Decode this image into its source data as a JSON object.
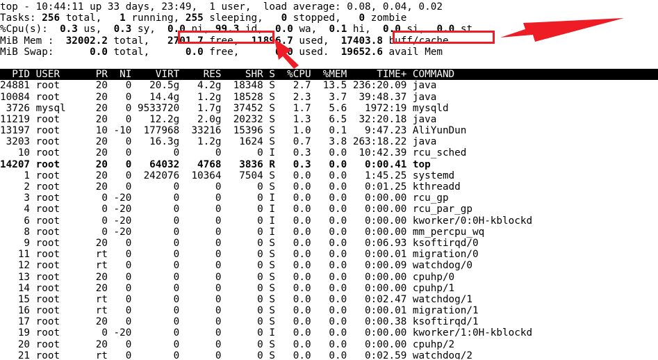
{
  "terminal": {
    "app": "top",
    "summary": {
      "line1": "top - 10:44:11 up 33 days, 23:49,  1 user,  load average: 0.08, 0.04, 0.02",
      "line2": "Tasks: 256 total,   1 running, 255 sleeping,   0 stopped,   0 zombie",
      "line3": "%Cpu(s):  0.3 us,  0.3 sy,  0.0 ni, 99.3 id,  0.0 wa,  0.1 hi,  0.0 si,  0.0 st",
      "line4": "MiB Mem :  32002.2 total,   2701.7 free,  11896.7 used,  17403.8 buff/cache",
      "line5": "MiB Swap:      0.0 total,      0.0 free,      0.0 used.  19652.6 avail Mem",
      "uptime_time": "10:44:11",
      "up_days": "33 days, 23:49",
      "users": "1 user",
      "load_average": [
        "0.08",
        "0.04",
        "0.02"
      ],
      "tasks": {
        "total": "256",
        "running": "1",
        "sleeping": "255",
        "stopped": "0",
        "zombie": "0"
      },
      "cpu": {
        "us": "0.3",
        "sy": "0.3",
        "ni": "0.0",
        "id": "99.3",
        "wa": "0.0",
        "hi": "0.1",
        "si": "0.0",
        "st": "0.0"
      },
      "mem": {
        "unit": "MiB Mem :",
        "total": "32002.2",
        "free": "2701.7",
        "used": "11896.7",
        "buff_cache": "17403.8"
      },
      "swap": {
        "unit": "MiB Swap:",
        "total": "0.0",
        "free": "0.0",
        "used": "0.0",
        "avail_mem": "19652.6"
      }
    },
    "columns_line": "  PID USER      PR  NI    VIRT    RES    SHR S  %CPU  %MEM     TIME+ COMMAND                                                                      ",
    "columns": [
      "PID",
      "USER",
      "PR",
      "NI",
      "VIRT",
      "RES",
      "SHR",
      "S",
      "%CPU",
      "%MEM",
      "TIME+",
      "COMMAND"
    ],
    "rows": [
      {
        "line": "24881 root      20   0   20.5g   4.2g  18348 S   2.7  13.5 236:20.09 java",
        "bold": false
      },
      {
        "line": "10084 root      20   0   14.4g   1.2g  18528 S   2.3   3.7  39:48.37 java",
        "bold": false
      },
      {
        "line": " 3726 mysql     20   0 9533720   1.7g  37452 S   1.7   5.6   1972:19 mysqld",
        "bold": false
      },
      {
        "line": "11219 root      20   0   12.2g   2.0g  20232 S   1.3   6.5  32:20.18 java",
        "bold": false
      },
      {
        "line": "13197 root      10 -10  177968  33216  15396 S   1.0   0.1   9:47.23 AliYunDun",
        "bold": false
      },
      {
        "line": " 3203 root      20   0   16.3g   1.2g   1624 S   0.7   3.8 263:18.22 java",
        "bold": false
      },
      {
        "line": "   10 root      20   0       0      0      0 I   0.3   0.0  10:42.39 rcu_sched",
        "bold": false
      },
      {
        "line": "14207 root      20   0   64032   4768   3836 R   0.3   0.0   0:00.41 top",
        "bold": true
      },
      {
        "line": "    1 root      20   0  242076  10364   7504 S   0.0   0.0   1:45.25 systemd",
        "bold": false
      },
      {
        "line": "    2 root      20   0       0      0      0 S   0.0   0.0   0:01.25 kthreadd",
        "bold": false
      },
      {
        "line": "    3 root       0 -20       0      0      0 I   0.0   0.0   0:00.00 rcu_gp",
        "bold": false
      },
      {
        "line": "    4 root       0 -20       0      0      0 I   0.0   0.0   0:00.00 rcu_par_gp",
        "bold": false
      },
      {
        "line": "    6 root       0 -20       0      0      0 I   0.0   0.0   0:00.00 kworker/0:0H-kblockd",
        "bold": false
      },
      {
        "line": "    8 root       0 -20       0      0      0 I   0.0   0.0   0:00.00 mm_percpu_wq",
        "bold": false
      },
      {
        "line": "    9 root      20   0       0      0      0 S   0.0   0.0   0:06.93 ksoftirqd/0",
        "bold": false
      },
      {
        "line": "   11 root      rt   0       0      0      0 S   0.0   0.0   0:00.01 migration/0",
        "bold": false
      },
      {
        "line": "   12 root      rt   0       0      0      0 S   0.0   0.0   0:00.09 watchdog/0",
        "bold": false
      },
      {
        "line": "   13 root      20   0       0      0      0 S   0.0   0.0   0:00.00 cpuhp/0",
        "bold": false
      },
      {
        "line": "   14 root      20   0       0      0      0 S   0.0   0.0   0:00.00 cpuhp/1",
        "bold": false
      },
      {
        "line": "   15 root      rt   0       0      0      0 S   0.0   0.0   0:02.47 watchdog/1",
        "bold": false
      },
      {
        "line": "   16 root      rt   0       0      0      0 S   0.0   0.0   0:00.01 migration/1",
        "bold": false
      },
      {
        "line": "   17 root      20   0       0      0      0 S   0.0   0.0   0:00.38 ksoftirqd/1",
        "bold": false
      },
      {
        "line": "   19 root       0 -20       0      0      0 I   0.0   0.0   0:00.00 kworker/1:0H-kblockd",
        "bold": false
      },
      {
        "line": "   20 root      20   0       0      0      0 S   0.0   0.0   0:00.00 cpuhp/2",
        "bold": false
      },
      {
        "line": "   21 root      rt   0       0      0      0 S   0.0   0.0   0:02.59 watchdog/2",
        "bold": false
      }
    ]
  },
  "annotations": {
    "accent_color": "#ee1c25",
    "highlight_free": "2701.7 free,",
    "highlight_buff_cache": "17403.8 buff/cache",
    "arrow1_target": "2701.7 free,",
    "arrow2_target": "17403.8 buff/cache"
  }
}
